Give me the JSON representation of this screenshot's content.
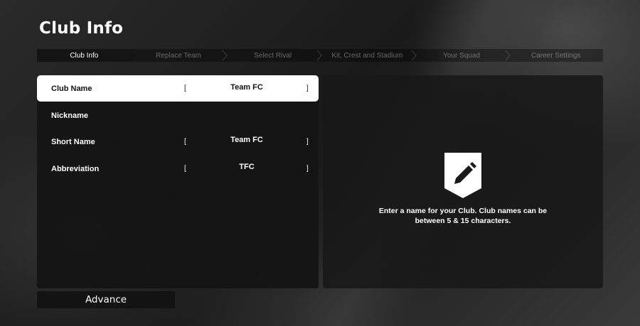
{
  "page_title": "Club Info",
  "steps": [
    {
      "label": "Club Info",
      "active": true
    },
    {
      "label": "Replace Team",
      "active": false
    },
    {
      "label": "Select Rival",
      "active": false
    },
    {
      "label": "Kit, Crest and Stadium",
      "active": false
    },
    {
      "label": "Your Squad",
      "active": false
    },
    {
      "label": "Career Settings",
      "active": false
    }
  ],
  "fields": [
    {
      "label": "Club Name",
      "value": "Team FC",
      "selected": true,
      "open_bracket": "[",
      "close_bracket": "]"
    },
    {
      "label": "Nickname",
      "value": "",
      "selected": false,
      "open_bracket": "",
      "close_bracket": ""
    },
    {
      "label": "Short Name",
      "value": "Team FC",
      "selected": false,
      "open_bracket": "[",
      "close_bracket": "]"
    },
    {
      "label": "Abbreviation",
      "value": "TFC",
      "selected": false,
      "open_bracket": "[",
      "close_bracket": "]"
    }
  ],
  "help": {
    "icon": "pencil-shield-icon",
    "text": "Enter a name for your Club. Club names can be between 5 & 15 characters."
  },
  "advance_label": "Advance"
}
